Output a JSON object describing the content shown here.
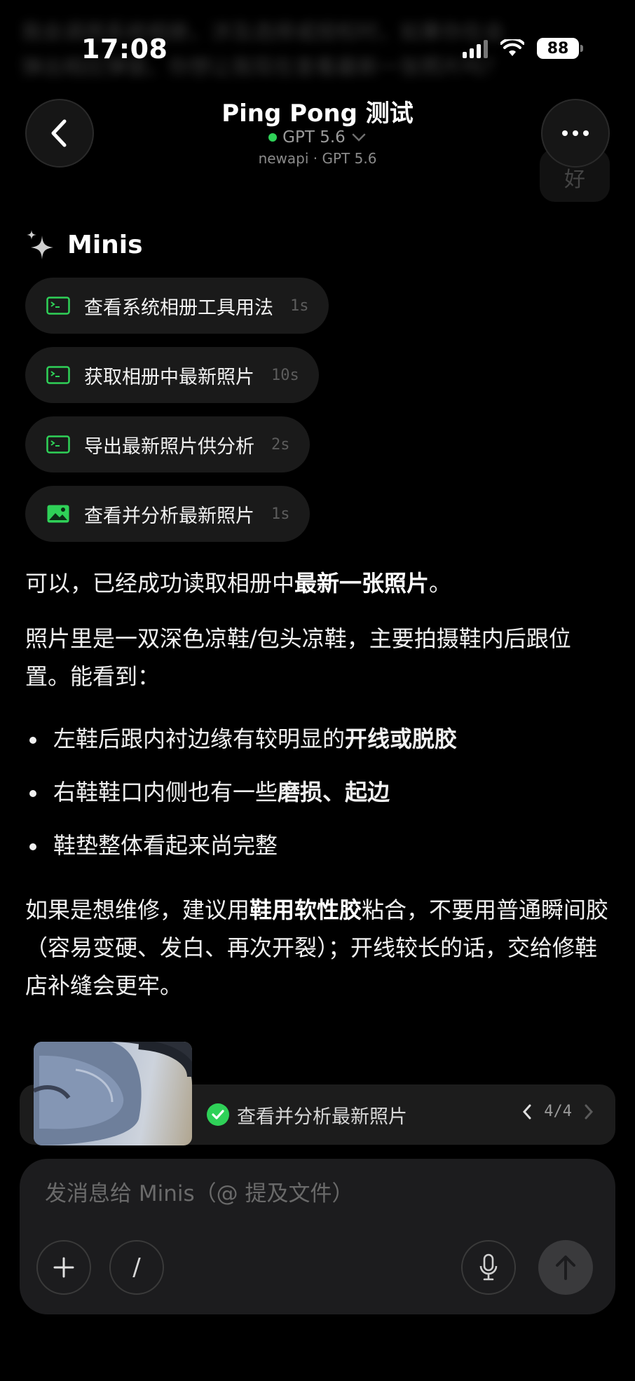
{
  "status_bar": {
    "time": "17:08",
    "battery": "88"
  },
  "background_text": {
    "line1": "我会调用系统相册，涉及选择或授权时，如果你在会",
    "line2": "弹出相应弹窗。你想让我现在查看最新一张照片吗？"
  },
  "header": {
    "title": "Ping Pong 测试",
    "model": "GPT 5.6",
    "provider": "newapi · GPT 5.6",
    "ghost_bubble": "好"
  },
  "minis": {
    "title": "Minis",
    "tools": [
      {
        "icon": "terminal-icon",
        "label": "查看系统相册工具用法",
        "duration": "1s"
      },
      {
        "icon": "terminal-icon",
        "label": "获取相册中最新照片",
        "duration": "10s"
      },
      {
        "icon": "terminal-icon",
        "label": "导出最新照片供分析",
        "duration": "2s"
      },
      {
        "icon": "image-icon",
        "label": "查看并分析最新照片",
        "duration": "1s"
      }
    ]
  },
  "response": {
    "p1_prefix": "可以，已经成功读取相册中",
    "p1_bold": "最新一张照片",
    "p1_suffix": "。",
    "p2": "照片里是一双深色凉鞋/包头凉鞋，主要拍摄鞋内后跟位置。能看到：",
    "bullets": [
      {
        "text": "左鞋后跟内衬边缘有较明显的",
        "bold": "开线或脱胶",
        "after": ""
      },
      {
        "text": "右鞋鞋口内侧也有一些",
        "bold": "磨损、起边",
        "after": ""
      },
      {
        "text": "鞋垫整体看起来尚完整",
        "bold": "",
        "after": ""
      }
    ],
    "p3_prefix": "如果是想维修，建议用",
    "p3_bold": "鞋用软性胶",
    "p3_suffix": "粘合，不要用普通瞬间胶（容易变硬、发白、再次开裂）；开线较长的话，交给修鞋店补缝会更牢。"
  },
  "task_bar": {
    "label": "查看并分析最新照片",
    "count": "4/4"
  },
  "composer": {
    "placeholder": "发消息给 Minis（@ 提及文件）",
    "slash": "/"
  },
  "colors": {
    "accent_green": "#2fd158",
    "background": "#000000",
    "pill_bg": "#1a1a1a"
  }
}
